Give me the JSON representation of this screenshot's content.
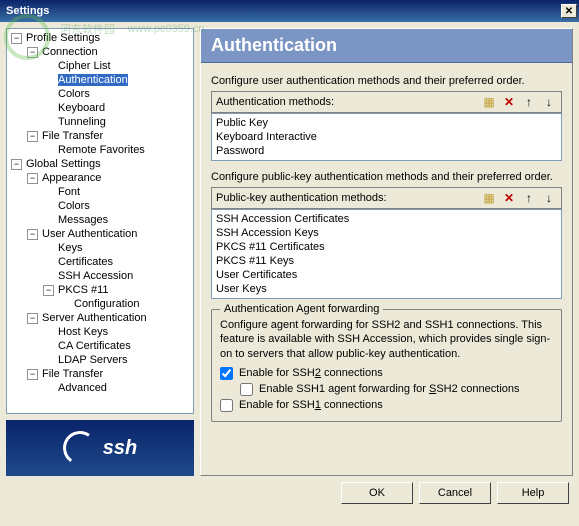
{
  "title": "Settings",
  "watermark": {
    "text": "河东软件园",
    "url": "www.pc0359.cn"
  },
  "tree": {
    "profile": "Profile Settings",
    "connection": "Connection",
    "cipher": "Cipher List",
    "auth": "Authentication",
    "colors": "Colors",
    "keyboard": "Keyboard",
    "tunneling": "Tunneling",
    "filetransfer": "File Transfer",
    "remote": "Remote Favorites",
    "global": "Global Settings",
    "appearance": "Appearance",
    "font": "Font",
    "gcolors": "Colors",
    "messages": "Messages",
    "userauth": "User Authentication",
    "keys": "Keys",
    "certs": "Certificates",
    "sshacc": "SSH Accession",
    "pkcs": "PKCS #11",
    "config": "Configuration",
    "serverauth": "Server Authentication",
    "hostkeys": "Host Keys",
    "cacerts": "CA Certificates",
    "ldap": "LDAP Servers",
    "gfiletransfer": "File Transfer",
    "advanced": "Advanced"
  },
  "panel": {
    "title": "Authentication",
    "desc1": "Configure user authentication methods and their preferred order.",
    "hdr1": "Authentication methods:",
    "methods": [
      "Public Key",
      "Keyboard Interactive",
      "Password"
    ],
    "desc2": "Configure public-key authentication methods and their preferred order.",
    "hdr2": "Public-key authentication methods:",
    "pkmethods": [
      "SSH Accession Certificates",
      "SSH Accession Keys",
      "PKCS #11 Certificates",
      "PKCS #11 Keys",
      "User Certificates",
      "User Keys"
    ],
    "group_title": "Authentication Agent forwarding",
    "group_desc": "Configure agent forwarding for SSH2 and SSH1 connections. This feature is available with SSH Accession, which provides single sign-on to servers that allow public-key authentication.",
    "chk1": "Enable for SSH2 connections",
    "chk2": "Enable SSH1 agent forwarding for SSH2 connections",
    "chk3": "Enable for SSH1 connections"
  },
  "buttons": {
    "ok": "OK",
    "cancel": "Cancel",
    "help": "Help"
  },
  "logo": "ssh"
}
